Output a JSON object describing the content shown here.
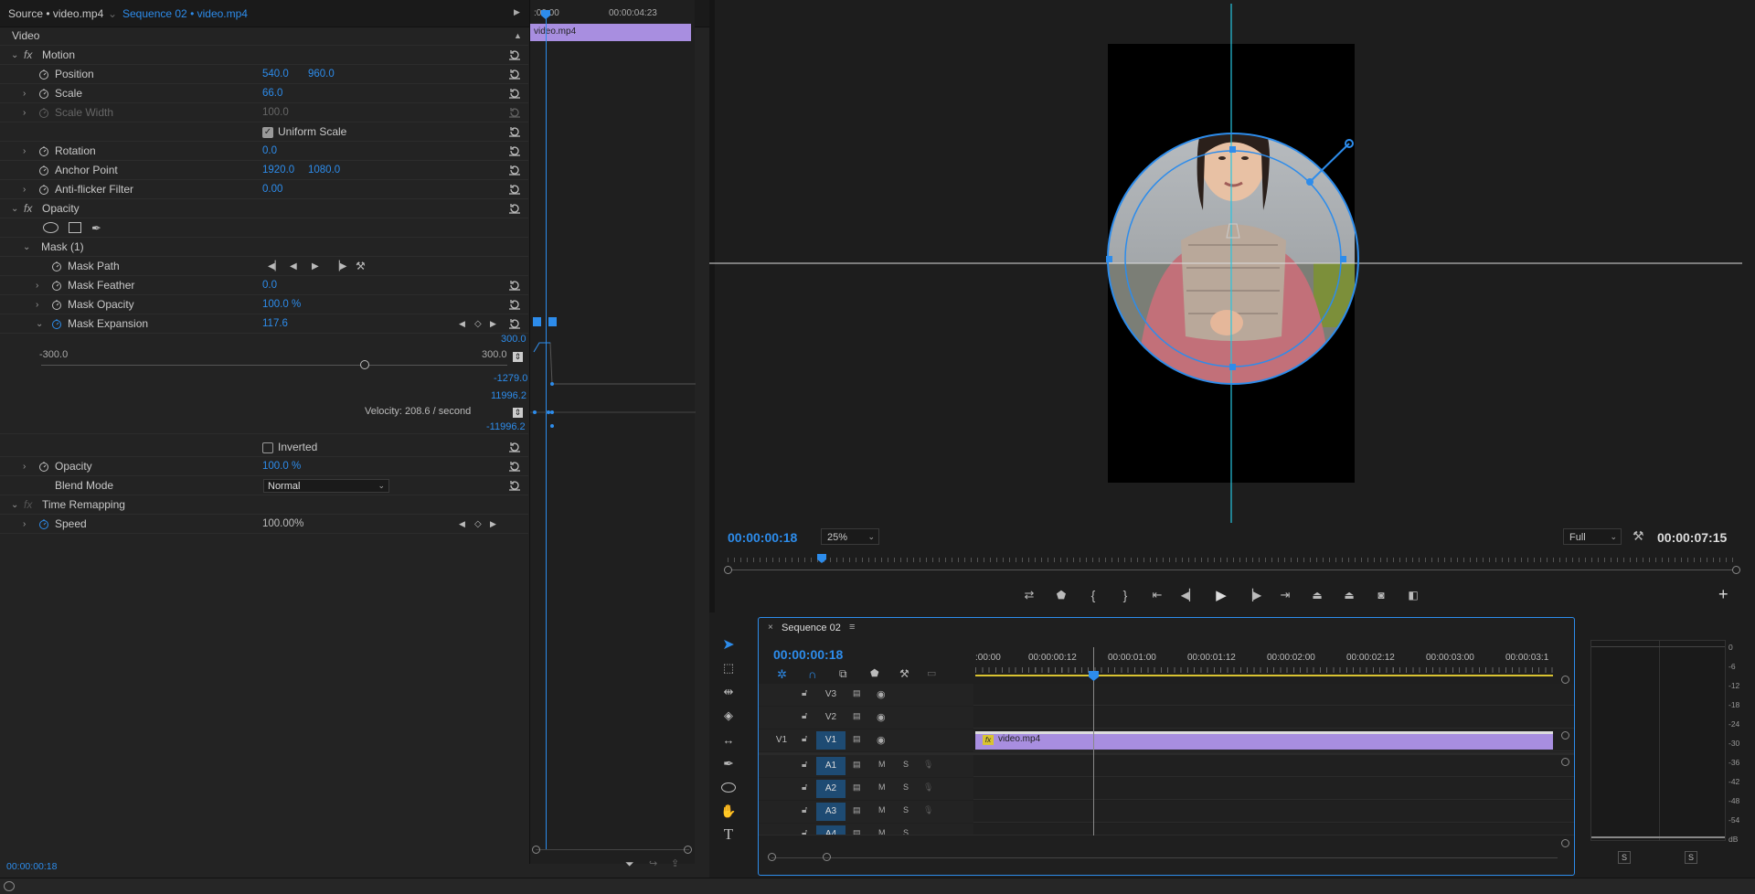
{
  "effect_controls": {
    "source_tab": "Source • video.mp4",
    "sequence_tab": "Sequence 02 • video.mp4",
    "section": "Video",
    "motion": {
      "label": "Motion",
      "position": {
        "label": "Position",
        "x": "540.0",
        "y": "960.0"
      },
      "scale": {
        "label": "Scale",
        "value": "66.0"
      },
      "scale_width": {
        "label": "Scale Width",
        "value": "100.0"
      },
      "uniform_scale": {
        "label": "Uniform Scale",
        "checked": true
      },
      "rotation": {
        "label": "Rotation",
        "value": "0.0"
      },
      "anchor": {
        "label": "Anchor Point",
        "x": "1920.0",
        "y": "1080.0"
      },
      "antiflicker": {
        "label": "Anti-flicker Filter",
        "value": "0.00"
      }
    },
    "opacity": {
      "label": "Opacity",
      "mask": {
        "label": "Mask (1)",
        "path": "Mask Path",
        "feather": {
          "label": "Mask Feather",
          "value": "0.0"
        },
        "opacity": {
          "label": "Mask Opacity",
          "value": "100.0 %"
        },
        "expansion": {
          "label": "Mask Expansion",
          "value": "117.6"
        },
        "graph_max": "300.0",
        "slider_min": "-300.0",
        "slider_max": "300.0",
        "graph_val1": "-1279.0",
        "graph_val2": "11996.2",
        "graph_val3": "-11996.2",
        "velocity": "Velocity: 208.6 / second",
        "inverted": "Inverted"
      },
      "opacity_prop": {
        "label": "Opacity",
        "value": "100.0 %"
      },
      "blend": {
        "label": "Blend Mode",
        "value": "Normal"
      }
    },
    "time_remap": {
      "label": "Time Remapping",
      "speed_label": "Speed",
      "speed_value": "100.00%"
    },
    "timecode_start": ":00:00",
    "timecode_end": "00:00:04:23",
    "clip_name": "video.mp4",
    "bottom_timecode": "00:00:00:18"
  },
  "program": {
    "timecode": "00:00:00:18",
    "zoom": "25%",
    "quality": "Full",
    "duration": "00:00:07:15"
  },
  "timeline": {
    "title": "Sequence 02",
    "timecode": "00:00:00:18",
    "ruler": [
      ":00:00",
      "00:00:00:12",
      "00:00:01:00",
      "00:00:01:12",
      "00:00:02:00",
      "00:00:02:12",
      "00:00:03:00",
      "00:00:03:1"
    ],
    "video_tracks": [
      "V3",
      "V2",
      "V1"
    ],
    "audio_tracks": [
      "A1",
      "A2",
      "A3",
      "A4"
    ],
    "source_patch": "V1",
    "clip": "video.mp4",
    "m": "M",
    "s": "S"
  },
  "meter": {
    "scale": [
      "0",
      "-6",
      "-12",
      "-18",
      "-24",
      "-30",
      "-36",
      "-42",
      "-48",
      "-54",
      "dB"
    ],
    "solo": "S"
  }
}
